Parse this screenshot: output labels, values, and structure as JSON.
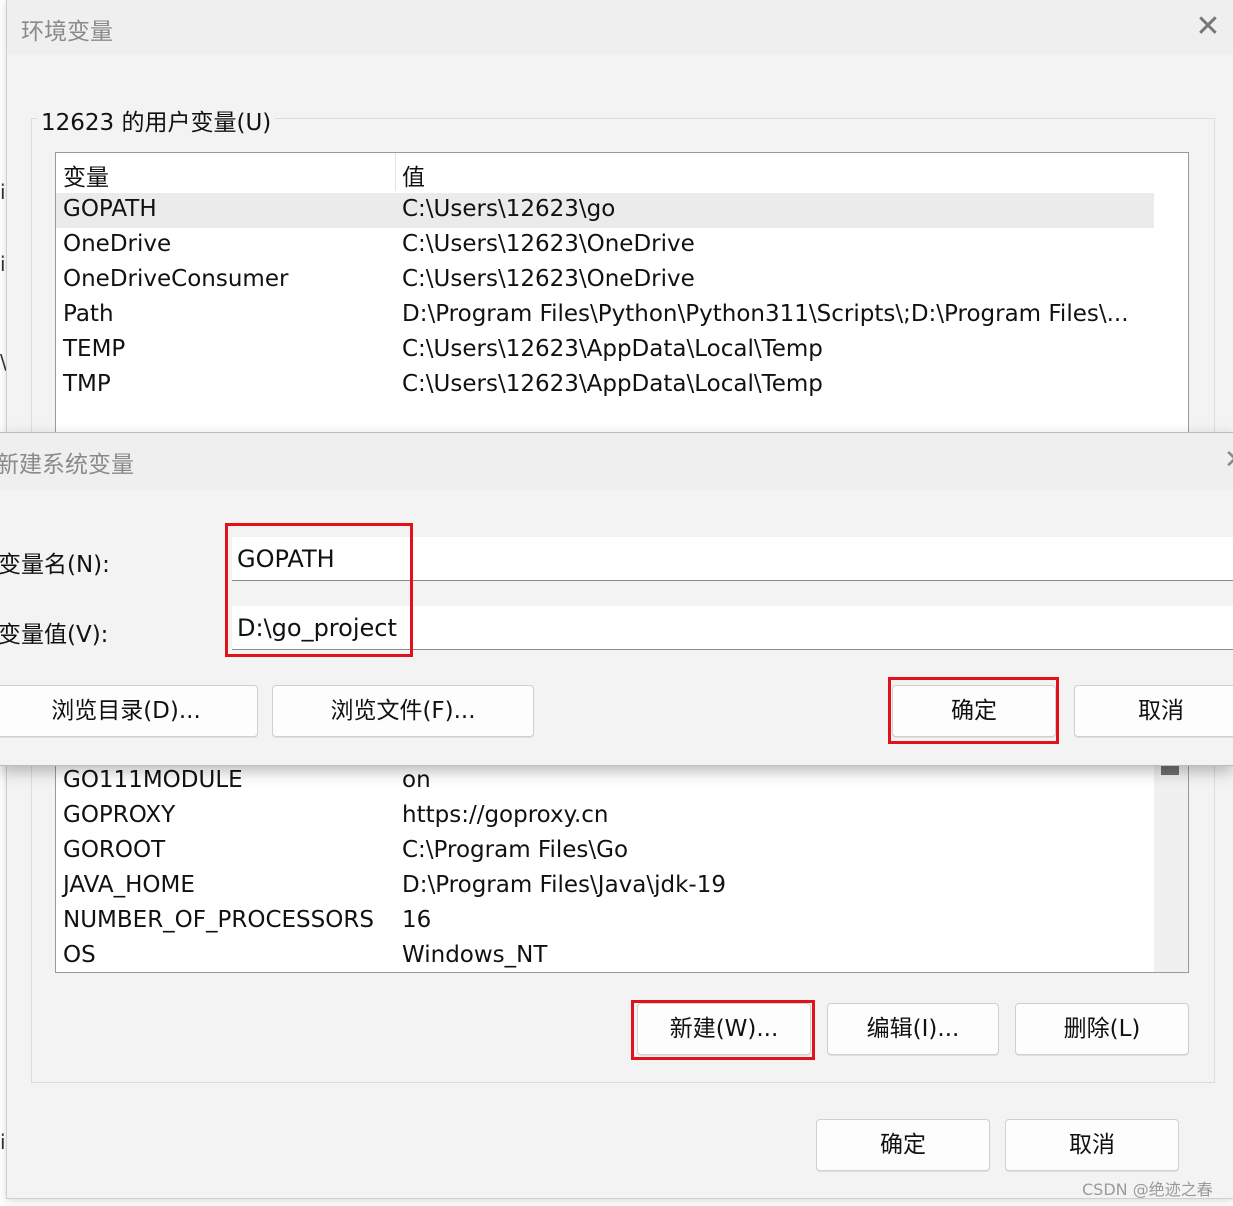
{
  "env_dialog": {
    "title": "环境变量",
    "close_glyph": "✕",
    "user_section_label": "12623 的用户变量(U)",
    "columns": {
      "name": "变量",
      "value": "值"
    },
    "user_vars": [
      {
        "name": "GOPATH",
        "value": "C:\\Users\\12623\\go"
      },
      {
        "name": "OneDrive",
        "value": "C:\\Users\\12623\\OneDrive"
      },
      {
        "name": "OneDriveConsumer",
        "value": "C:\\Users\\12623\\OneDrive"
      },
      {
        "name": "Path",
        "value": "D:\\Program Files\\Python\\Python311\\Scripts\\;D:\\Program Files\\..."
      },
      {
        "name": "TEMP",
        "value": "C:\\Users\\12623\\AppData\\Local\\Temp"
      },
      {
        "name": "TMP",
        "value": "C:\\Users\\12623\\AppData\\Local\\Temp"
      }
    ],
    "system_vars": [
      {
        "name": "GO111MODULE",
        "value": "on"
      },
      {
        "name": "GOPROXY",
        "value": "https://goproxy.cn"
      },
      {
        "name": "GOROOT",
        "value": "C:\\Program Files\\Go"
      },
      {
        "name": "JAVA_HOME",
        "value": "D:\\Program Files\\Java\\jdk-19"
      },
      {
        "name": "NUMBER_OF_PROCESSORS",
        "value": "16"
      },
      {
        "name": "OS",
        "value": "Windows_NT"
      }
    ],
    "system_buttons": {
      "new": "新建(W)...",
      "edit": "编辑(I)...",
      "delete": "删除(L)"
    },
    "footer_buttons": {
      "ok": "确定",
      "cancel": "取消"
    }
  },
  "new_var_dialog": {
    "title": "新建系统变量",
    "name_label": "变量名(N):",
    "value_label": "变量值(V):",
    "name_value": "GOPATH",
    "value_value": "D:\\go_project",
    "browse_dir": "浏览目录(D)...",
    "browse_file": "浏览文件(F)...",
    "ok": "确定",
    "cancel": "取消",
    "close_glyph": "✕"
  },
  "edge_glyphs": [
    "i",
    "i",
    "\\",
    "i"
  ],
  "watermark": "CSDN @绝迹之春",
  "colors": {
    "highlight_box": "#e0131d",
    "selected_row": "#ebebeb"
  }
}
